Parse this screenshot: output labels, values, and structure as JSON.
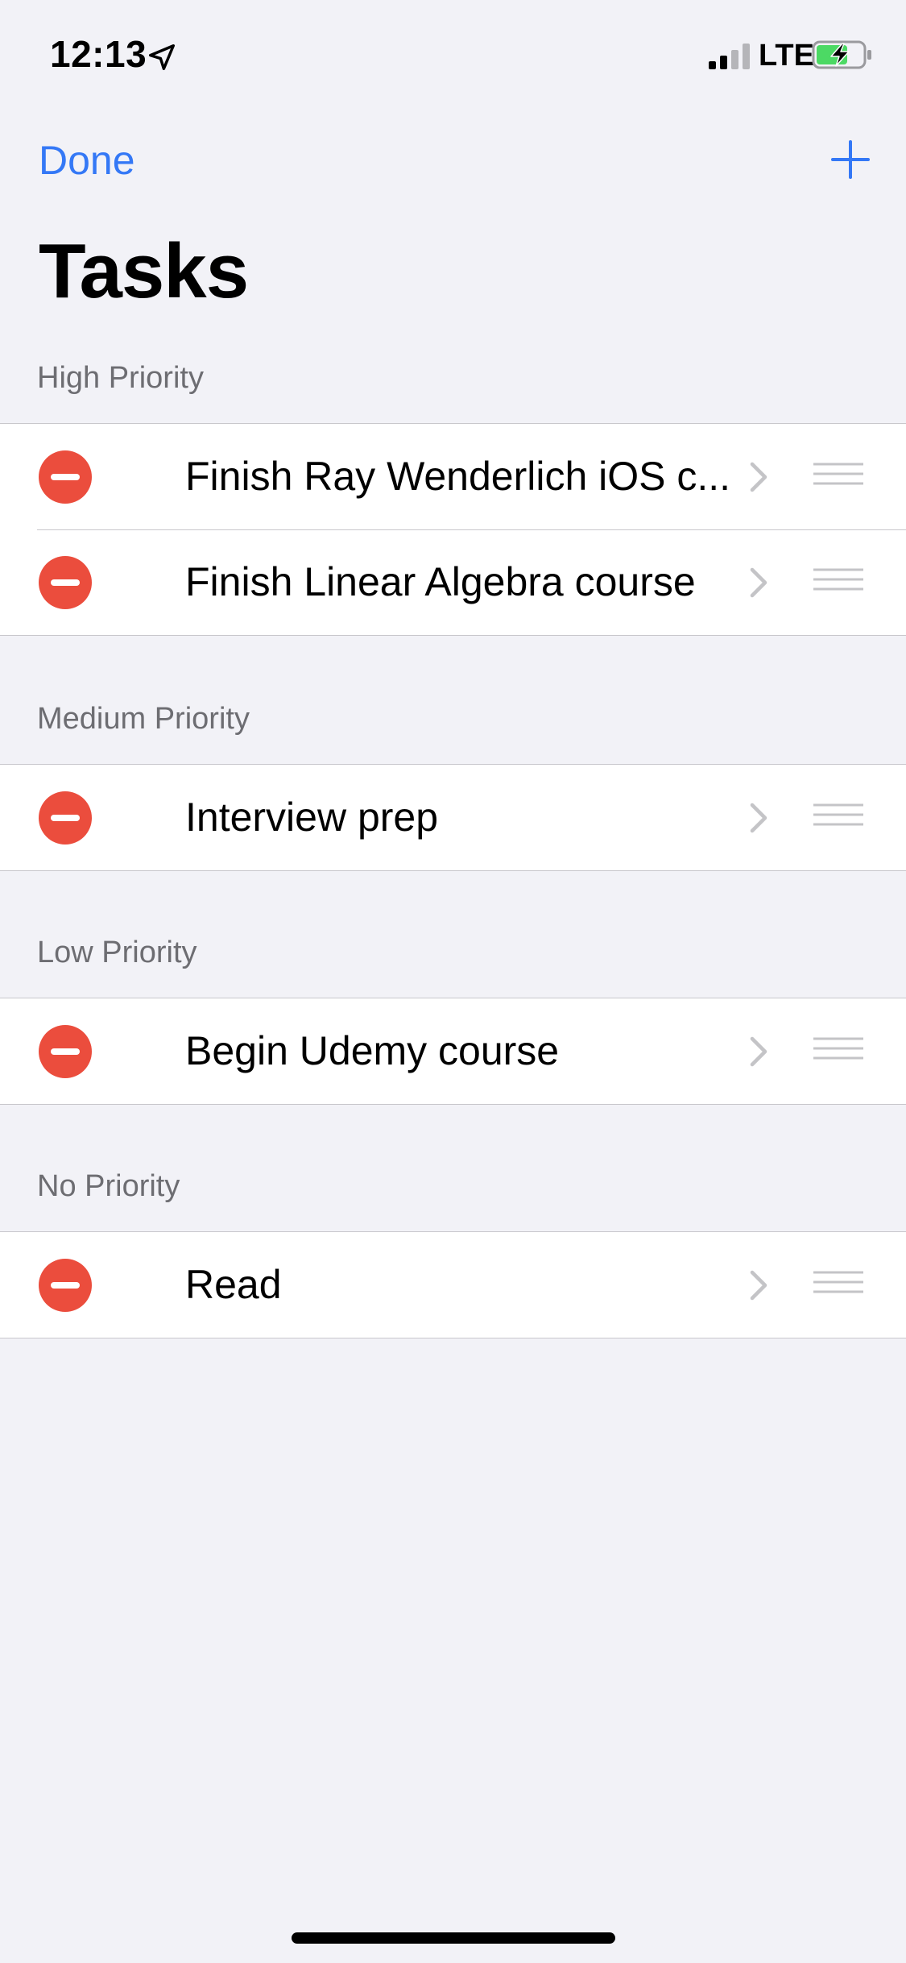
{
  "status_bar": {
    "time": "12:13",
    "network": "LTE",
    "icons": [
      "location-icon",
      "signal-icon",
      "battery-charging-icon"
    ]
  },
  "nav": {
    "done_label": "Done",
    "add_icon": "plus-icon",
    "title": "Tasks"
  },
  "sections": [
    {
      "header": "High Priority",
      "items": [
        {
          "title": "Finish Ray Wenderlich iOS c..."
        },
        {
          "title": "Finish Linear Algebra course"
        }
      ]
    },
    {
      "header": "Medium Priority",
      "items": [
        {
          "title": "Interview prep"
        }
      ]
    },
    {
      "header": "Low Priority",
      "items": [
        {
          "title": "Begin Udemy course"
        }
      ]
    },
    {
      "header": "No Priority",
      "items": [
        {
          "title": "Read"
        }
      ]
    }
  ],
  "colors": {
    "accent": "#3478f6",
    "delete": "#eb4d3d",
    "background": "#f2f2f7",
    "battery_fill": "#4cd964"
  }
}
